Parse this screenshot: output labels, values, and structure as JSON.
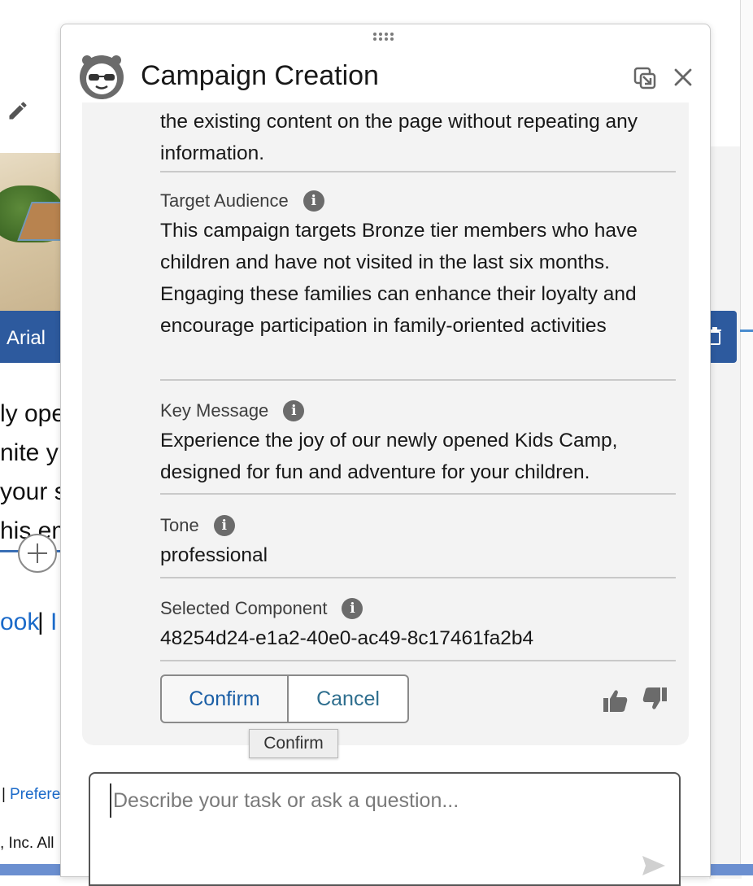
{
  "background": {
    "toolbar_font": "Arial",
    "text_lines": [
      "ly ope",
      "nite y",
      "your s",
      "his em"
    ],
    "links": {
      "left": "ook",
      "sep": "|",
      "right": "I"
    },
    "footer_sep": "|",
    "footer_link": "Prefere",
    "copyright": ", Inc. All"
  },
  "panel": {
    "title": "Campaign Creation",
    "fields": [
      {
        "label": "",
        "value": "the existing content on the page without repeating any information."
      },
      {
        "label": "Target Audience",
        "value": "This campaign targets Bronze tier members who have children and have not visited in the last six months. Engaging these families can enhance their loyalty and encourage participation in family-oriented activities"
      },
      {
        "label": "Key Message",
        "value": "Experience the joy of our newly opened Kids Camp, designed for fun and adventure for your children."
      },
      {
        "label": "Tone",
        "value": "professional"
      },
      {
        "label": "Selected Component",
        "value": "48254d24-e1a2-40e0-ac49-8c17461fa2b4"
      }
    ],
    "info_glyph": "i",
    "buttons": {
      "confirm": "Confirm",
      "cancel": "Cancel"
    },
    "tooltip": "Confirm",
    "composer": {
      "placeholder": "Describe your task or ask a question...",
      "value": ""
    }
  },
  "colors": {
    "toolbar": "#2d5a9e",
    "link": "#1b6ac9",
    "button_text": "#1b5fa6"
  }
}
